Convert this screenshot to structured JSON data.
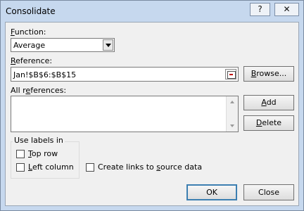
{
  "window": {
    "title": "Consolidate",
    "help_glyph": "?",
    "close_glyph": "✕"
  },
  "function_field": {
    "label_prefix": "",
    "label_accel": "F",
    "label_rest": "unction:",
    "selected": "Average"
  },
  "reference_field": {
    "label_accel": "R",
    "label_rest": "eference:",
    "value": "Jan!$B$6:$B$15",
    "collapse_icon": "range-collapse-icon"
  },
  "browse_button": {
    "pre": "",
    "accel": "B",
    "rest": "rowse..."
  },
  "all_references": {
    "label_pre": "All r",
    "label_accel": "e",
    "label_rest": "ferences:",
    "items": []
  },
  "add_button": {
    "pre": "",
    "accel": "A",
    "rest": "dd"
  },
  "delete_button": {
    "pre": "",
    "accel": "D",
    "rest": "elete"
  },
  "use_labels": {
    "title": "Use labels in",
    "top_row": {
      "accel": "T",
      "rest": "op row",
      "checked": false
    },
    "left_column": {
      "accel": "L",
      "rest": "eft column",
      "checked": false
    }
  },
  "create_links": {
    "pre": "Create links to ",
    "accel": "s",
    "rest": "ource data",
    "checked": false
  },
  "ok_button": "OK",
  "close_button": "Close"
}
